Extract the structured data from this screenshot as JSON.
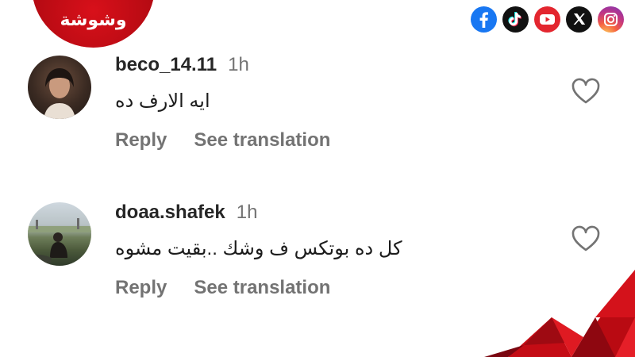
{
  "brand": {
    "logo_text": "وشوشة",
    "color": "#c40c15"
  },
  "social": {
    "icons": [
      "facebook-icon",
      "tiktok-icon",
      "youtube-icon",
      "x-icon",
      "instagram-icon"
    ]
  },
  "comments": [
    {
      "username": "beco_14.11",
      "time": "1h",
      "text": "ايه الارف ده",
      "reply_label": "Reply",
      "translate_label": "See translation"
    },
    {
      "username": "doaa.shafek",
      "time": "1h",
      "text": "كل ده بوتكس ف وشك ..بقيت مشوه",
      "reply_label": "Reply",
      "translate_label": "See translation"
    }
  ],
  "colors": {
    "text_primary": "#262626",
    "text_secondary": "#737373",
    "accent_red": "#c40c15"
  }
}
